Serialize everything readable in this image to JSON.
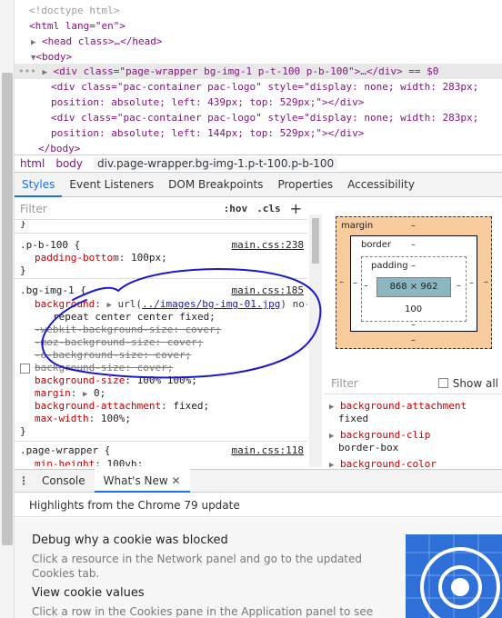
{
  "dom": {
    "lines": [
      "<!doctype html>",
      "<html lang=\"en\">",
      "<head class>…</head>",
      "<body>",
      "<div class=\"page-wrapper bg-img-1 p-t-100 p-b-100\">…</div> == $0",
      "<div class=\"pac-container pac-logo\" style=\"display: none; width: 283px;",
      "position: absolute; left: 439px; top: 529px;\"></div>",
      "<div class=\"pac-container pac-logo\" style=\"display: none; width: 283px;",
      "position: absolute; left: 144px; top: 529px;\"></div>",
      "</body>"
    ]
  },
  "breadcrumbs": [
    "html",
    "body",
    "div.page-wrapper.bg-img-1.p-t-100.p-b-100"
  ],
  "styles_tabs": [
    "Styles",
    "Event Listeners",
    "DOM Breakpoints",
    "Properties",
    "Accessibility"
  ],
  "filter": {
    "placeholder": "Filter",
    "hov": ":hov",
    "cls": ".cls",
    "plus": "+"
  },
  "rules": {
    "pb100": {
      "selector": ".p-b-100 {",
      "source": "main.css:238",
      "prop": "padding-bottom",
      "value": "100px;",
      "close": "}"
    },
    "bgimg": {
      "selector": ".bg-img-1 {",
      "source": "main.css:185",
      "bg_name": "background",
      "bg_url_pre": "url(",
      "bg_url": "../images/bg-img-01.jpg",
      "bg_url_post": ") no-",
      "bg_cont": "repeat center center fixed;",
      "webkit": "-webkit-background-size: cover;",
      "moz": "-moz-background-size: cover;",
      "o": "-o-background-size: cover;",
      "bgsize_struck": "background-size: cover;",
      "bgsize_name": "background-size",
      "bgsize_val": "100% 100%;",
      "margin_name": "margin",
      "margin_val": "0;",
      "attach_name": "background-attachment",
      "attach_val": "fixed;",
      "maxw_name": "max-width",
      "maxw_val": "100%;",
      "close": "}"
    },
    "pw": {
      "selector": ".page-wrapper {",
      "source": "main.css:118",
      "prop": "min-height",
      "value": "100vh;"
    }
  },
  "boxmodel": {
    "margin": "margin",
    "border": "border",
    "padding": "padding",
    "content": "868 × 962",
    "padding_bottom": "100",
    "dash": "–"
  },
  "computed": {
    "filter_placeholder": "Filter",
    "show_all": "Show all",
    "props": [
      {
        "name": "background-attachment",
        "value": "fixed"
      },
      {
        "name": "background-clip",
        "value": "border-box"
      },
      {
        "name": "background-color",
        "value": ""
      }
    ]
  },
  "drawer": {
    "tabs": [
      "Console",
      "What's New"
    ],
    "highlights": "Highlights from the Chrome 79 update",
    "items": [
      {
        "title": "Debug why a cookie was blocked",
        "desc1": "Click a resource in the Network panel and go to the updated",
        "desc2": "Cookies tab."
      },
      {
        "title": "View cookie values",
        "desc1": "Click a row in the Cookies pane in the Application panel to see",
        "desc2": ""
      }
    ]
  },
  "colors": {
    "accent": "#1a73e8",
    "annotation": "#1a1acc",
    "margin_box": "#f9cc9d",
    "content_box": "#8cb6c0"
  }
}
